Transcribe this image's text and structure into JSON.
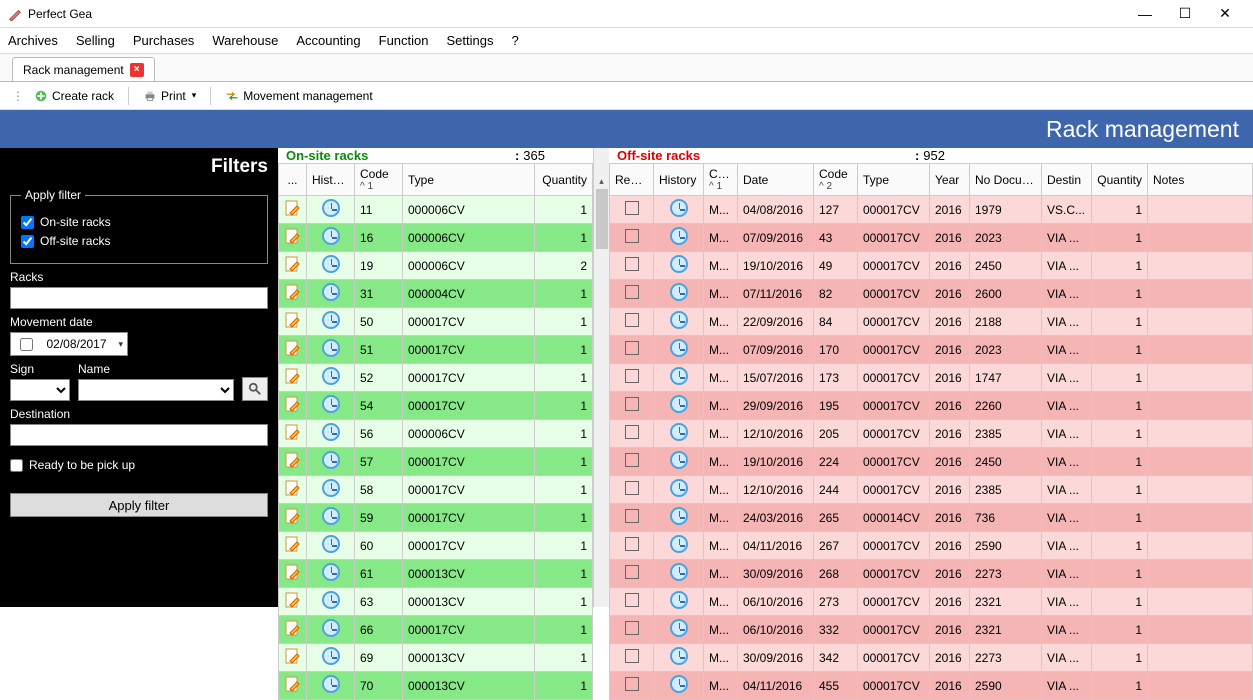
{
  "window": {
    "title": "Perfect Gea"
  },
  "menubar": [
    "Archives",
    "Selling",
    "Purchases",
    "Warehouse",
    "Accounting",
    "Function",
    "Settings",
    "?"
  ],
  "tab": {
    "label": "Rack management"
  },
  "toolbar": {
    "create": "Create rack",
    "print": "Print",
    "movement": "Movement management"
  },
  "banner": "Rack management",
  "filters": {
    "title": "Filters",
    "legend": "Apply filter",
    "chk_onsite": "On-site racks",
    "chk_offsite": "Off-site racks",
    "racks_label": "Racks",
    "movement_label": "Movement date",
    "movement_date": "02/08/2017",
    "sign_label": "Sign",
    "name_label": "Name",
    "dest_label": "Destination",
    "ready_label": "Ready to be pick up",
    "apply_btn": "Apply filter"
  },
  "onsite": {
    "title": "On-site racks",
    "count": "365",
    "headers": {
      "dots": "...",
      "history": "History",
      "code": "Code",
      "codesub": "^ 1",
      "type": "Type",
      "qty": "Quantity"
    },
    "rows": [
      {
        "hl": false,
        "code": "11",
        "type": "000006CV",
        "qty": "1"
      },
      {
        "hl": true,
        "code": "16",
        "type": "000006CV",
        "qty": "1"
      },
      {
        "hl": false,
        "code": "19",
        "type": "000006CV",
        "qty": "2"
      },
      {
        "hl": true,
        "code": "31",
        "type": "000004CV",
        "qty": "1"
      },
      {
        "hl": false,
        "code": "50",
        "type": "000017CV",
        "qty": "1"
      },
      {
        "hl": true,
        "code": "51",
        "type": "000017CV",
        "qty": "1"
      },
      {
        "hl": false,
        "code": "52",
        "type": "000017CV",
        "qty": "1"
      },
      {
        "hl": true,
        "code": "54",
        "type": "000017CV",
        "qty": "1"
      },
      {
        "hl": false,
        "code": "56",
        "type": "000006CV",
        "qty": "1"
      },
      {
        "hl": true,
        "code": "57",
        "type": "000017CV",
        "qty": "1"
      },
      {
        "hl": false,
        "code": "58",
        "type": "000017CV",
        "qty": "1"
      },
      {
        "hl": true,
        "code": "59",
        "type": "000017CV",
        "qty": "1"
      },
      {
        "hl": false,
        "code": "60",
        "type": "000017CV",
        "qty": "1"
      },
      {
        "hl": true,
        "code": "61",
        "type": "000013CV",
        "qty": "1"
      },
      {
        "hl": false,
        "code": "63",
        "type": "000013CV",
        "qty": "1"
      },
      {
        "hl": true,
        "code": "66",
        "type": "000017CV",
        "qty": "1"
      },
      {
        "hl": false,
        "code": "69",
        "type": "000013CV",
        "qty": "1"
      },
      {
        "hl": true,
        "code": "70",
        "type": "000013CV",
        "qty": "1"
      }
    ]
  },
  "offsite": {
    "title": "Off-site racks",
    "count": "952",
    "headers": {
      "ready": "Ready",
      "history": "History",
      "cust": "Cust",
      "custsub": "^ 1",
      "date": "Date",
      "code": "Code",
      "codesub": "^ 2",
      "type": "Type",
      "year": "Year",
      "nodoc": "No Document",
      "destin": "Destin",
      "qty": "Quantity",
      "notes": "Notes"
    },
    "rows": [
      {
        "hl": false,
        "cust": "M...",
        "date": "04/08/2016",
        "code": "127",
        "type": "000017CV",
        "year": "2016",
        "nodoc": "1979",
        "dest": "VS.C...",
        "qty": "1"
      },
      {
        "hl": true,
        "cust": "M...",
        "date": "07/09/2016",
        "code": "43",
        "type": "000017CV",
        "year": "2016",
        "nodoc": "2023",
        "dest": "VIA ...",
        "qty": "1"
      },
      {
        "hl": false,
        "cust": "M...",
        "date": "19/10/2016",
        "code": "49",
        "type": "000017CV",
        "year": "2016",
        "nodoc": "2450",
        "dest": "VIA ...",
        "qty": "1"
      },
      {
        "hl": true,
        "cust": "M...",
        "date": "07/11/2016",
        "code": "82",
        "type": "000017CV",
        "year": "2016",
        "nodoc": "2600",
        "dest": "VIA ...",
        "qty": "1"
      },
      {
        "hl": false,
        "cust": "M...",
        "date": "22/09/2016",
        "code": "84",
        "type": "000017CV",
        "year": "2016",
        "nodoc": "2188",
        "dest": "VIA ...",
        "qty": "1"
      },
      {
        "hl": true,
        "cust": "M...",
        "date": "07/09/2016",
        "code": "170",
        "type": "000017CV",
        "year": "2016",
        "nodoc": "2023",
        "dest": "VIA ...",
        "qty": "1"
      },
      {
        "hl": false,
        "cust": "M...",
        "date": "15/07/2016",
        "code": "173",
        "type": "000017CV",
        "year": "2016",
        "nodoc": "1747",
        "dest": "VIA ...",
        "qty": "1"
      },
      {
        "hl": true,
        "cust": "M...",
        "date": "29/09/2016",
        "code": "195",
        "type": "000017CV",
        "year": "2016",
        "nodoc": "2260",
        "dest": "VIA ...",
        "qty": "1"
      },
      {
        "hl": false,
        "cust": "M...",
        "date": "12/10/2016",
        "code": "205",
        "type": "000017CV",
        "year": "2016",
        "nodoc": "2385",
        "dest": "VIA ...",
        "qty": "1"
      },
      {
        "hl": true,
        "cust": "M...",
        "date": "19/10/2016",
        "code": "224",
        "type": "000017CV",
        "year": "2016",
        "nodoc": "2450",
        "dest": "VIA ...",
        "qty": "1"
      },
      {
        "hl": false,
        "cust": "M...",
        "date": "12/10/2016",
        "code": "244",
        "type": "000017CV",
        "year": "2016",
        "nodoc": "2385",
        "dest": "VIA ...",
        "qty": "1"
      },
      {
        "hl": true,
        "cust": "M...",
        "date": "24/03/2016",
        "code": "265",
        "type": "000014CV",
        "year": "2016",
        "nodoc": "736",
        "dest": "VIA ...",
        "qty": "1"
      },
      {
        "hl": false,
        "cust": "M...",
        "date": "04/11/2016",
        "code": "267",
        "type": "000017CV",
        "year": "2016",
        "nodoc": "2590",
        "dest": "VIA ...",
        "qty": "1"
      },
      {
        "hl": true,
        "cust": "M...",
        "date": "30/09/2016",
        "code": "268",
        "type": "000017CV",
        "year": "2016",
        "nodoc": "2273",
        "dest": "VIA ...",
        "qty": "1"
      },
      {
        "hl": false,
        "cust": "M...",
        "date": "06/10/2016",
        "code": "273",
        "type": "000017CV",
        "year": "2016",
        "nodoc": "2321",
        "dest": "VIA ...",
        "qty": "1"
      },
      {
        "hl": true,
        "cust": "M...",
        "date": "06/10/2016",
        "code": "332",
        "type": "000017CV",
        "year": "2016",
        "nodoc": "2321",
        "dest": "VIA ...",
        "qty": "1"
      },
      {
        "hl": false,
        "cust": "M...",
        "date": "30/09/2016",
        "code": "342",
        "type": "000017CV",
        "year": "2016",
        "nodoc": "2273",
        "dest": "VIA ...",
        "qty": "1"
      },
      {
        "hl": true,
        "cust": "M...",
        "date": "04/11/2016",
        "code": "455",
        "type": "000017CV",
        "year": "2016",
        "nodoc": "2590",
        "dest": "VIA ...",
        "qty": "1"
      }
    ]
  }
}
